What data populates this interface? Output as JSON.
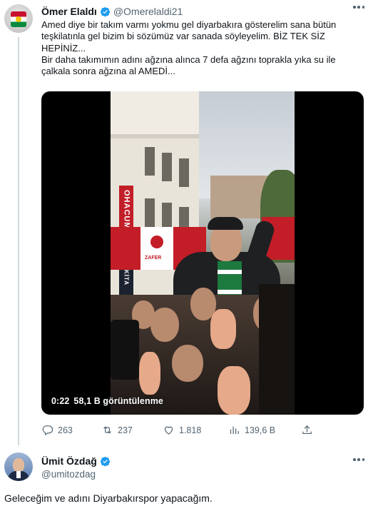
{
  "tweet1": {
    "author": {
      "name": "Ömer Elaldı",
      "handle": "@Omerelaldi21",
      "verified": true
    },
    "text_lines": [
      "Amed diye bir takım varmı yokmu gel diyarbakıra gösterelim sana bütün",
      "teşkilatınla gel bizim bi sözümüz var sanada söyleyelim. BİZ TEK SİZ",
      "HEPİNİZ...",
      "Bir daha takımımın adını ağzına alınca 7 defa ağzını toprakla yıka su ile",
      "çalkala sonra ağzına al AMEDİ..."
    ],
    "media": {
      "duration": "0:22",
      "views": "58,1 B görüntülenme",
      "sign_text": "OHACUMRE",
      "banner_label": "ZAFER",
      "lower_sign": "KİTA"
    },
    "actions": {
      "replies": "263",
      "retweets": "237",
      "likes": "1.818",
      "views": "139,6 B"
    }
  },
  "tweet2": {
    "author": {
      "name": "Ümit Özdağ",
      "handle": "@umitozdag",
      "verified": true
    },
    "text": "Geleceğim ve adını Diyarbakırspor yapacağım."
  },
  "colors": {
    "accent": "#1d9bf0",
    "secondary_text": "#536471",
    "primary_text": "#0f1419",
    "thread_line": "#cfd9de"
  },
  "icons": [
    "more-icon",
    "verified-badge-icon",
    "reply-icon",
    "retweet-icon",
    "like-icon",
    "views-icon",
    "share-icon"
  ]
}
